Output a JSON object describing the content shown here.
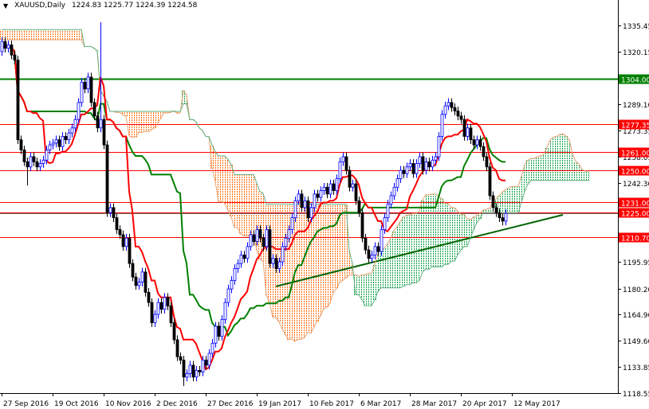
{
  "header": {
    "symbol": "XAUUSD,Daily",
    "ohlc_text": "1224.83 1225.77 1224.39 1224.58",
    "menu_icon": "triangle-down-icon"
  },
  "colors": {
    "bull": "#0000ff",
    "bear": "#000000",
    "tenkan": "#ff0000",
    "kijun": "#008000",
    "cloud_bear": "#ff6a00",
    "cloud_bull": "#00a040",
    "level_red": "#ff0000",
    "level_green": "#008000",
    "trendline": "#006400"
  },
  "chart_data": {
    "type": "candlestick",
    "title": "XAUUSD,Daily",
    "ylim": [
      1118.55,
      1335.45
    ],
    "y_ticks": [
      1335.45,
      1320.15,
      1289.1,
      1273.35,
      1258.05,
      1242.3,
      1195.95,
      1180.2,
      1164.9,
      1149.6,
      1133.85,
      1118.55
    ],
    "x_labels": [
      {
        "bar": 0,
        "label": "27 Sep 2016"
      },
      {
        "bar": 16,
        "label": "19 Oct 2016"
      },
      {
        "bar": 32,
        "label": "10 Nov 2016"
      },
      {
        "bar": 48,
        "label": "2 Dec 2016"
      },
      {
        "bar": 64,
        "label": "27 Dec 2016"
      },
      {
        "bar": 80,
        "label": "19 Jan 2017"
      },
      {
        "bar": 96,
        "label": "10 Feb 2017"
      },
      {
        "bar": 112,
        "label": "6 Mar 2017"
      },
      {
        "bar": 128,
        "label": "28 Mar 2017"
      },
      {
        "bar": 144,
        "label": "20 Apr 2017"
      },
      {
        "bar": 160,
        "label": "12 May 2017"
      }
    ],
    "closes": [
      1326,
      1322,
      1324,
      1318,
      1315,
      1268,
      1262,
      1255,
      1252,
      1258,
      1255,
      1252,
      1254,
      1256,
      1262,
      1265,
      1266,
      1268,
      1264,
      1270,
      1268,
      1272,
      1275,
      1280,
      1290,
      1302,
      1298,
      1305,
      1290,
      1282,
      1275,
      1280,
      1265,
      1225,
      1228,
      1222,
      1215,
      1212,
      1205,
      1210,
      1195,
      1187,
      1182,
      1184,
      1190,
      1178,
      1172,
      1160,
      1165,
      1172,
      1168,
      1175,
      1170,
      1160,
      1150,
      1140,
      1138,
      1128,
      1130,
      1135,
      1128,
      1132,
      1131,
      1138,
      1135,
      1142,
      1148,
      1158,
      1152,
      1162,
      1172,
      1180,
      1185,
      1192,
      1195,
      1200,
      1198,
      1205,
      1212,
      1208,
      1215,
      1210,
      1205,
      1215,
      1195,
      1198,
      1192,
      1196,
      1205,
      1210,
      1215,
      1222,
      1232,
      1236,
      1228,
      1232,
      1222,
      1228,
      1236,
      1234,
      1238,
      1240,
      1236,
      1242,
      1238,
      1245,
      1255,
      1258,
      1250,
      1240,
      1242,
      1232,
      1225,
      1210,
      1203,
      1198,
      1200,
      1205,
      1202,
      1215,
      1222,
      1230,
      1235,
      1240,
      1245,
      1250,
      1248,
      1252,
      1254,
      1248,
      1254,
      1258,
      1250,
      1255,
      1252,
      1256,
      1258,
      1270,
      1283,
      1288,
      1290,
      1287,
      1285,
      1282,
      1280,
      1270,
      1275,
      1268,
      1265,
      1268,
      1264,
      1258,
      1252,
      1235,
      1228,
      1225,
      1222,
      1220,
      1224.58
    ],
    "first_open": 1320,
    "extremes": [
      {
        "bar": 31,
        "high": 1337.4
      },
      {
        "bar": 57,
        "low": 1122.7
      },
      {
        "bar": 8,
        "low": 1241
      }
    ],
    "indicators": {
      "ichimoku": {
        "tenkan": 9,
        "kijun": 26,
        "senkou_b": 52
      }
    },
    "levels": [
      {
        "price": 1304.0,
        "label": "1304.00",
        "color": "green"
      },
      {
        "price": 1277.35,
        "label": "1277.35",
        "color": "red"
      },
      {
        "price": 1261.0,
        "label": "1261.00",
        "color": "red"
      },
      {
        "price": 1250.0,
        "label": "1250.00",
        "color": "red"
      },
      {
        "price": 1231.0,
        "label": "1231.00",
        "color": "red"
      },
      {
        "price": 1225.0,
        "label": "1225.00",
        "color": "red"
      },
      {
        "price": 1210.7,
        "label": "1210.70",
        "color": "red"
      }
    ],
    "current_price": 1224.58,
    "trendline": [
      {
        "bar": 86,
        "price": 1181.5
      },
      {
        "bar": 176,
        "price": 1223.7
      }
    ]
  }
}
